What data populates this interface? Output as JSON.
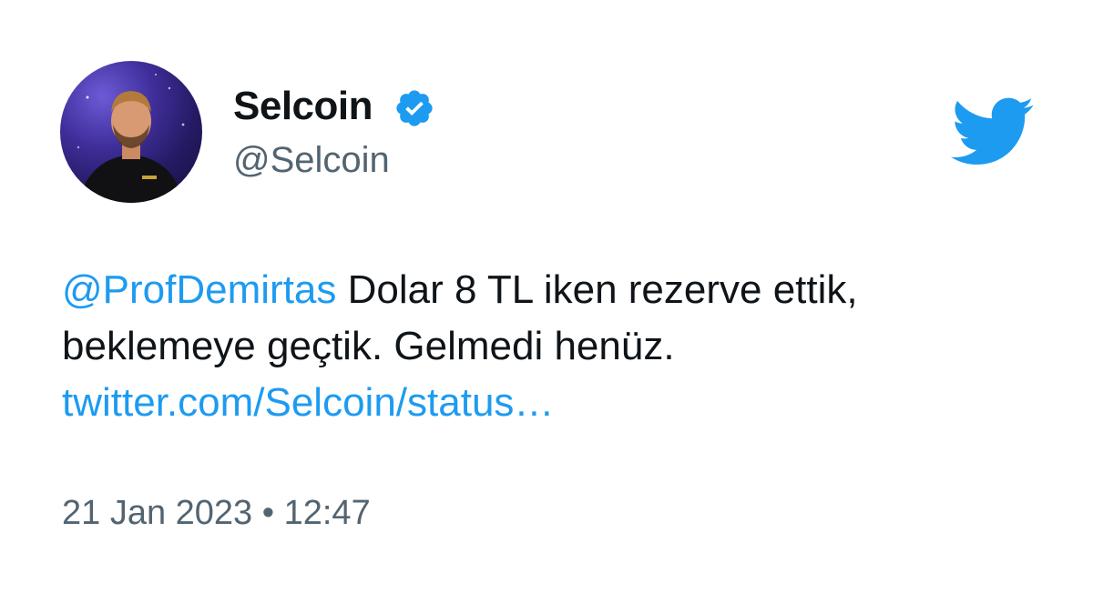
{
  "user": {
    "display_name": "Selcoin",
    "handle": "@Selcoin",
    "verified": true
  },
  "tweet": {
    "mention": "@ProfDemirtas",
    "text_line1": " Dolar 8 TL iken rezerve ettik,",
    "text_line2": "beklemeye geçtik. Gelmedi henüz.",
    "link": "twitter.com/Selcoin/status…"
  },
  "meta": {
    "date": "21 Jan 2023",
    "separator": " • ",
    "time": "12:47"
  },
  "icons": {
    "brand": "twitter-bird-icon",
    "verified": "verified-badge-icon"
  },
  "colors": {
    "brand_blue": "#1d9bf0",
    "text": "#0f1419",
    "secondary": "#536471"
  }
}
